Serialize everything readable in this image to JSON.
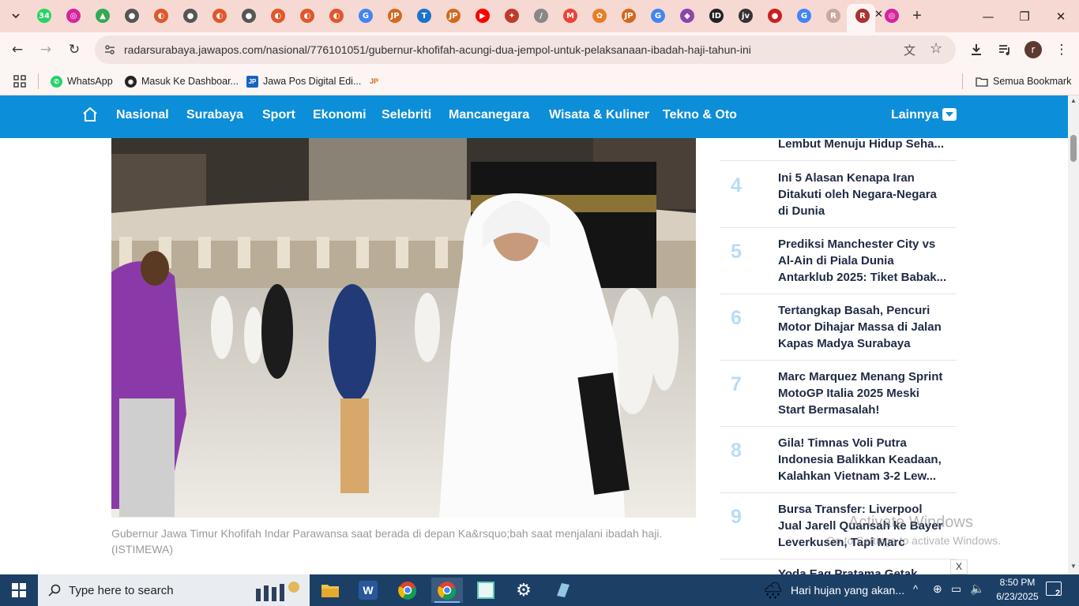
{
  "browser": {
    "tabs": [
      {
        "icon": "whatsapp-icon",
        "color": "#25d366",
        "glyph": "34"
      },
      {
        "icon": "instagram-icon",
        "color": "#d6249f",
        "glyph": "◎"
      },
      {
        "icon": "drive-icon",
        "color": "#34a853",
        "glyph": "▲"
      },
      {
        "icon": "web-icon",
        "color": "#555555",
        "glyph": "●"
      },
      {
        "icon": "ui-icon",
        "color": "#e0572b",
        "glyph": "◐"
      },
      {
        "icon": "web-icon",
        "color": "#555555",
        "glyph": "●"
      },
      {
        "icon": "ui-icon",
        "color": "#e0572b",
        "glyph": "◐"
      },
      {
        "icon": "web-icon",
        "color": "#555555",
        "glyph": "●"
      },
      {
        "icon": "ui-icon",
        "color": "#e0572b",
        "glyph": "◐"
      },
      {
        "icon": "ui-icon",
        "color": "#e0572b",
        "glyph": "◐"
      },
      {
        "icon": "ui-icon",
        "color": "#e0572b",
        "glyph": "◐"
      },
      {
        "icon": "google-icon",
        "color": "#4285f4",
        "glyph": "G"
      },
      {
        "icon": "jawapos-icon",
        "color": "#d2691e",
        "glyph": "JP"
      },
      {
        "icon": "t-icon",
        "color": "#1a73c9",
        "glyph": "T"
      },
      {
        "icon": "jawapos-icon",
        "color": "#d2691e",
        "glyph": "JP"
      },
      {
        "icon": "youtube-icon",
        "color": "#ff0000",
        "glyph": "▶"
      },
      {
        "icon": "emblem-icon",
        "color": "#c0392b",
        "glyph": "✦"
      },
      {
        "icon": "slash-icon",
        "color": "#888888",
        "glyph": "/"
      },
      {
        "icon": "gmail-icon",
        "color": "#ea4335",
        "glyph": "M"
      },
      {
        "icon": "bk-icon",
        "color": "#e67e22",
        "glyph": "✿"
      },
      {
        "icon": "jawapos-icon",
        "color": "#d2691e",
        "glyph": "JP"
      },
      {
        "icon": "google-icon",
        "color": "#4285f4",
        "glyph": "G"
      },
      {
        "icon": "diamond-icon",
        "color": "#8e44ad",
        "glyph": "◆"
      },
      {
        "icon": "id-icon",
        "color": "#222222",
        "glyph": "ID"
      },
      {
        "icon": "jtv-icon",
        "color": "#333333",
        "glyph": "jv"
      },
      {
        "icon": "red-icon",
        "color": "#cc1f1f",
        "glyph": "●"
      },
      {
        "icon": "google-icon",
        "color": "#4285f4",
        "glyph": "G"
      },
      {
        "icon": "radar-icon",
        "color": "#c8a8a0",
        "glyph": "R"
      },
      {
        "icon": "radar-icon",
        "color": "#aa3333",
        "glyph": "R",
        "active": true
      },
      {
        "icon": "instagram-icon",
        "color": "#d6249f",
        "glyph": "◎"
      }
    ],
    "url": "radarsurabaya.jawapos.com/nasional/776101051/gubernur-khofifah-acungi-dua-jempol-untuk-pelaksanaan-ibadah-haji-tahun-ini",
    "bookmarks": [
      {
        "label": "WhatsApp",
        "icon": "whatsapp-icon",
        "color": "#25d366"
      },
      {
        "label": "Masuk Ke Dashboar...",
        "icon": "dashboard-icon",
        "color": "#222222"
      },
      {
        "label": "Jawa Pos Digital Edi...",
        "icon": "jp-icon",
        "color": "#1565c0"
      },
      {
        "label": "",
        "icon": "jawapos-icon",
        "color": "#d2691e"
      }
    ],
    "all_bookmarks": "Semua Bookmark"
  },
  "site": {
    "nav": [
      "Nasional",
      "Surabaya",
      "Sport",
      "Ekonomi",
      "Selebriti",
      "Mancanegara",
      "Wisata & Kuliner",
      "Tekno & Oto"
    ],
    "more": "Lainnya",
    "caption": "Gubernur Jawa Timur Khofifah Indar Parawansa saat berada di depan Ka&rsquo;bah saat menjalani ibadah haji. (ISTIMEWA)",
    "trending_partial": "Lembut Menuju Hidup Seha...",
    "trending": [
      {
        "rank": "4",
        "title": "Ini 5 Alasan Kenapa Iran Ditakuti oleh Negara-Negara di Dunia"
      },
      {
        "rank": "5",
        "title": "Prediksi Manchester City vs Al-Ain di Piala Dunia Antarklub 2025: Tiket Babak..."
      },
      {
        "rank": "6",
        "title": "Tertangkap Basah, Pencuri Motor Dihajar Massa di Jalan Kapas Madya Surabaya"
      },
      {
        "rank": "7",
        "title": "Marc Marquez Menang Sprint MotoGP Italia 2025 Meski Start Bermasalah!"
      },
      {
        "rank": "8",
        "title": "Gila! Timnas Voli Putra Indonesia Balikkan Keadaan, Kalahkan Vietnam 3-2 Lew..."
      },
      {
        "rank": "9",
        "title": "Bursa Transfer: Liverpool Jual Jarell Quansah ke Bayer Leverkusen, Tapi Marc Gueh..."
      }
    ],
    "trending_next_partial": "Yoda Eag Pratama Getak",
    "watermark_line1": "Activate Windows",
    "watermark_line2": "Go to Settings to activate Windows.",
    "ad_close": "X"
  },
  "taskbar": {
    "search_placeholder": "Type here to search",
    "weather": "Hari hujan yang akan...",
    "time": "8:50 PM",
    "date": "6/23/2025",
    "notif_count": "2"
  }
}
